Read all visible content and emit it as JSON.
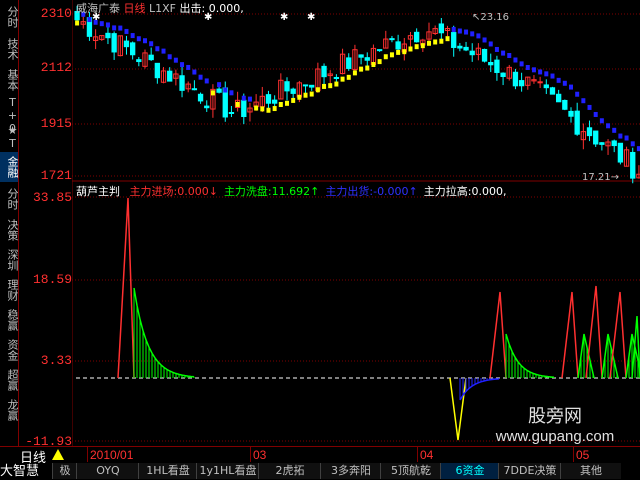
{
  "sidebar": {
    "items": [
      {
        "label": "分时"
      },
      {
        "label": "技术"
      },
      {
        "label": "基本"
      },
      {
        "label": "T+0"
      },
      {
        "label": "★T"
      },
      {
        "label": "金融"
      },
      {
        "label": "分时"
      },
      {
        "label": "决策"
      },
      {
        "label": "深圳"
      },
      {
        "label": "理财"
      },
      {
        "label": "稳赢"
      },
      {
        "label": "资金"
      },
      {
        "label": "超赢"
      },
      {
        "label": "龙赢"
      }
    ]
  },
  "price_panel": {
    "stock_name": "威海广泰",
    "period": "日线",
    "indicator": "L1XF",
    "signal_label": "出击:",
    "signal_value": "0.000,",
    "y_labels": [
      "2310",
      "2112",
      "1915",
      "1721"
    ],
    "high_annotation": "23.16",
    "low_annotation": "17.21"
  },
  "indicator_panel": {
    "name": "葫芦主判",
    "fields": [
      {
        "label": "主力进场:",
        "value": "0.000↓",
        "color": "#ff3030"
      },
      {
        "label": "主力洗盘:",
        "value": "11.692↑",
        "color": "#00ff00"
      },
      {
        "label": "主力出货:",
        "value": "-0.000↑",
        "color": "#3030ff"
      },
      {
        "label": "主力拉高:",
        "value": "0.000,",
        "color": "#ffffff"
      }
    ],
    "y_labels": [
      "33.85",
      "18.59",
      "3.33",
      "-11.93"
    ],
    "watermark_cn": "股旁网",
    "watermark_url": "www.gupang.com"
  },
  "date_axis": {
    "labels": [
      "2010/01",
      "03",
      "04",
      "05"
    ]
  },
  "bottom": {
    "brand": "大智慧",
    "period_label": "日线",
    "tabs": [
      {
        "label": "极",
        "active": false
      },
      {
        "label": "OYQ",
        "active": false
      },
      {
        "label": "1HL看盘",
        "active": false
      },
      {
        "label": "1y1HL看盘",
        "active": false
      },
      {
        "label": "2虎拓",
        "active": false
      },
      {
        "label": "3多奔阳",
        "active": false
      },
      {
        "label": "5顶航乾",
        "active": false
      },
      {
        "label": "6资金",
        "active": true
      },
      {
        "label": "7DDE决策",
        "active": false
      },
      {
        "label": "其他",
        "active": false
      }
    ]
  },
  "colors": {
    "up": "#ff3030",
    "down": "#00ffff",
    "ma_blue": "#2020ff",
    "ma_yellow": "#ffff00",
    "grid": "#800000"
  },
  "chart_data": [
    {
      "type": "candlestick",
      "ylim": [
        17.0,
        23.5
      ],
      "y_ticks": [
        23.1,
        21.12,
        19.15,
        17.21
      ],
      "annotations": [
        {
          "label": "23.16"
        },
        {
          "label": "17.21"
        }
      ]
    },
    {
      "type": "area",
      "title": "葫芦主判",
      "ylim": [
        -11.93,
        33.85
      ],
      "y_ticks": [
        33.85,
        18.59,
        3.33,
        -11.93
      ],
      "baseline": 0
    }
  ]
}
